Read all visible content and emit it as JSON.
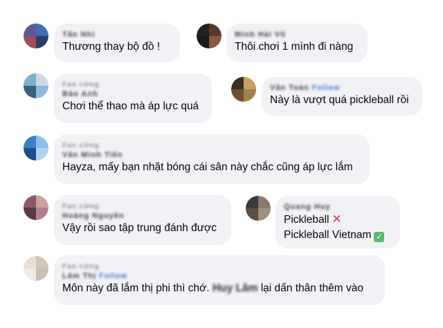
{
  "comments": [
    {
      "author": "Tấn Nhi",
      "tag": "",
      "badge": "",
      "text": "Thương thay bộ đồ !",
      "avatar_colors": [
        "#5a5a9a",
        "#3d6fb0",
        "#9a4f5a",
        "#2b3b6b"
      ]
    },
    {
      "author": "Minh Hải Vũ",
      "tag": "",
      "badge": "",
      "text": "Thôi chơi 1 mình đi nàng",
      "avatar_colors": [
        "#2a2020",
        "#5a3a2a",
        "#1a1a1a",
        "#8a5a40"
      ]
    },
    {
      "author": "Bảo Anh",
      "tag": "Fan cứng",
      "badge": "",
      "text": "Chơi thể thao mà áp lực quá",
      "avatar_colors": [
        "#7ab0d0",
        "#cfd8e0",
        "#3a6080",
        "#90b8d8"
      ]
    },
    {
      "author": "Văn Toàn",
      "tag": "",
      "badge": "Follow",
      "text": "Này là vượt quá pickleball rồi",
      "avatar_colors": [
        "#3a3020",
        "#c8a060",
        "#6a5030",
        "#a08050"
      ]
    },
    {
      "author": "Văn Minh Tiến",
      "tag": "Fan cứng",
      "badge": "",
      "text": "Hayza, mấy bạn nhặt bóng cái sân này chắc cũng áp lực lắm",
      "avatar_colors": [
        "#3a80c8",
        "#8cc0e8",
        "#1a4f90",
        "#b0d4f0"
      ]
    },
    {
      "author": "Hoàng Nguyên",
      "tag": "Fan cứng",
      "badge": "",
      "text": "Vậy rồi sao tập trung đánh được",
      "avatar_colors": [
        "#8a5a6a",
        "#d0a0a0",
        "#5a3a4a",
        "#b08090"
      ]
    },
    {
      "author": "Quang Huy",
      "tag": "",
      "badge": "",
      "text_line1": "Pickleball",
      "text_line2": "Pickleball Vietnam",
      "icon_1": "cross-mark-icon",
      "icon_2": "check-mark-icon",
      "avatar_colors": [
        "#3a3a3a",
        "#8a7a6a",
        "#5a5040",
        "#a09080"
      ]
    },
    {
      "author": "Lâm Thị",
      "tag": "Fan cứng",
      "badge": "Follow",
      "text": "Môn này đã lắm thị phi thì chớ.",
      "mention": "Huy Lâm",
      "text_after": "lại dấn thân thêm vào",
      "avatar_colors": [
        "#e8e0d0",
        "#d0c8b8",
        "#f0ece4",
        "#c8c0b0"
      ]
    }
  ]
}
